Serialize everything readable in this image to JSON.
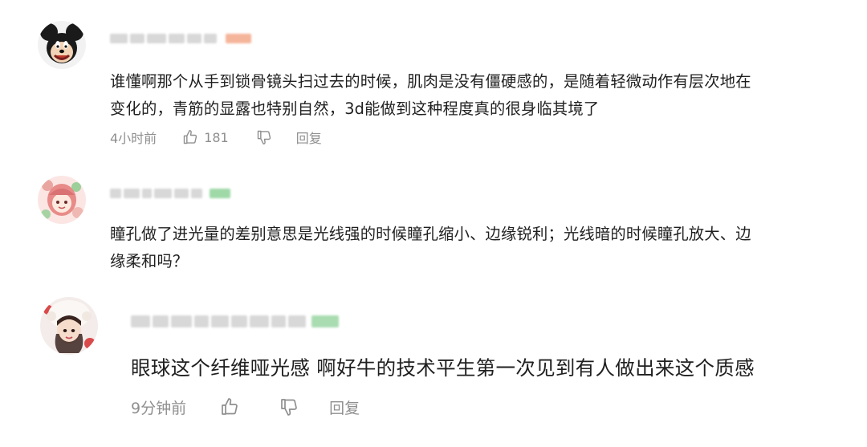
{
  "comments": [
    {
      "text_line1": "谁懂啊那个从手到锁骨镜头扫过去的时候，肌肉是没有僵硬感的，是随着轻微动作有层次地在",
      "text_line2": "变化的，青筋的显露也特别自然，3d能做到这种程度真的很身临其境了",
      "time": "4小时前",
      "likes": "181",
      "reply": "回复",
      "tag_color": "#f5b59a",
      "avatar_icon": "mickey-mouse-avatar-icon"
    },
    {
      "text_line1": "瞳孔做了进光量的差别意思是光线强的时候瞳孔缩小、边缘锐利；光线暗的时候瞳孔放大、边",
      "text_line2": "缘柔和吗？",
      "tag_color": "#9fd9a8",
      "avatar_icon": "anime-girl-avatar-icon"
    },
    {
      "text_line1": "眼球这个纤维哑光感 啊好牛的技术平生第一次见到有人做出来这个质感",
      "time": "9分钟前",
      "reply": "回复",
      "tag_color": "#a9dcb0",
      "avatar_icon": "girl-hat-avatar-icon"
    }
  ]
}
